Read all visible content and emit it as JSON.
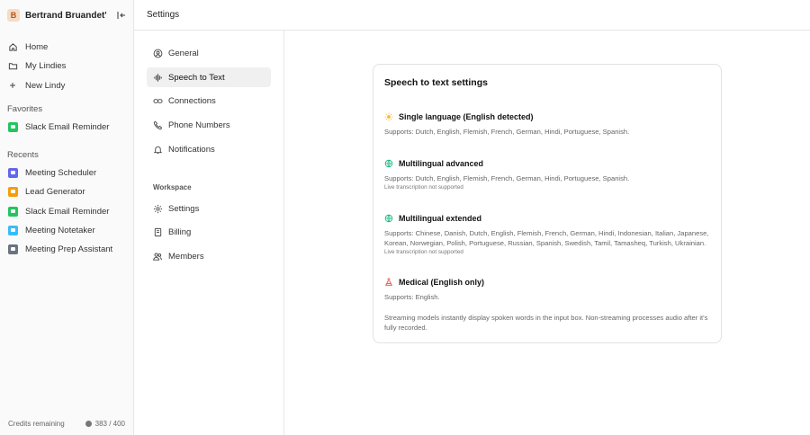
{
  "workspace": {
    "avatar_letter": "B",
    "name": "Bertrand Bruandet's..."
  },
  "nav": [
    {
      "label": "Home",
      "icon": "home-icon"
    },
    {
      "label": "My Lindies",
      "icon": "folder-icon"
    },
    {
      "label": "New Lindy",
      "icon": "plus-icon"
    }
  ],
  "favorites": {
    "label": "Favorites",
    "items": [
      {
        "label": "Slack Email Reminder",
        "color": "#22c55e"
      }
    ]
  },
  "recents": {
    "label": "Recents",
    "items": [
      {
        "label": "Meeting Scheduler",
        "color": "#6366f1"
      },
      {
        "label": "Lead Generator",
        "color": "#f59e0b"
      },
      {
        "label": "Slack Email Reminder",
        "color": "#22c55e"
      },
      {
        "label": "Meeting Notetaker",
        "color": "#38bdf8"
      },
      {
        "label": "Meeting Prep Assistant",
        "color": "#6b7280"
      }
    ]
  },
  "credits": {
    "label": "Credits remaining",
    "value": "383 / 400"
  },
  "header": {
    "title": "Settings"
  },
  "settings_nav": {
    "items": [
      {
        "label": "General"
      },
      {
        "label": "Speech to Text"
      },
      {
        "label": "Connections"
      },
      {
        "label": "Phone Numbers"
      },
      {
        "label": "Notifications"
      }
    ],
    "workspace_label": "Workspace",
    "workspace_items": [
      {
        "label": "Settings"
      },
      {
        "label": "Billing"
      },
      {
        "label": "Members"
      }
    ]
  },
  "card": {
    "title": "Speech to text settings",
    "options": [
      {
        "title": "Single language (English detected)",
        "supports": "Supports: Dutch, English, Flemish, French, German, Hindi, Portuguese, Spanish.",
        "note": ""
      },
      {
        "title": "Multilingual advanced",
        "supports": "Supports: Dutch, English, Flemish, French, German, Hindi, Portuguese, Spanish.",
        "note": "Live transcription not supported"
      },
      {
        "title": "Multilingual extended",
        "supports": "Supports: Chinese, Danish, Dutch, English, Flemish, French, German, Hindi, Indonesian, Italian, Japanese, Korean, Norwegian, Polish, Portuguese, Russian, Spanish, Swedish, Tamil, Tamasheq, Turkish, Ukrainian.",
        "note": "Live transcription not supported"
      },
      {
        "title": "Medical (English only)",
        "supports": "Supports: English.",
        "note": ""
      }
    ],
    "footnote": "Streaming models instantly display spoken words in the input box. Non-streaming processes audio after it's fully recorded."
  }
}
